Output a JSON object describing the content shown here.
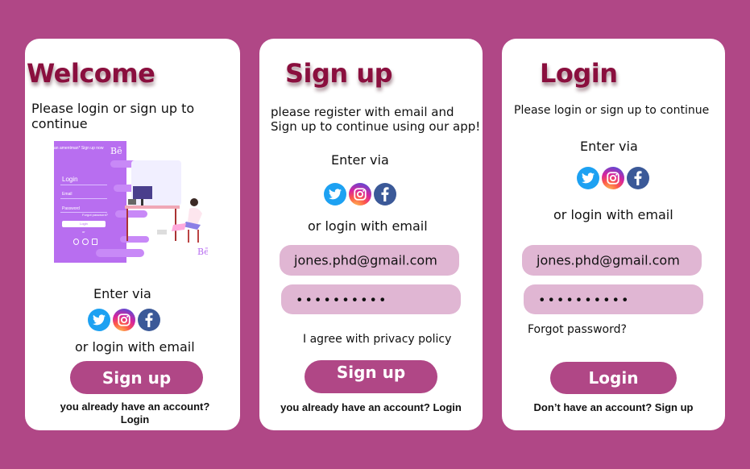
{
  "welcome": {
    "title": "Welcome",
    "subtitle": "Please login or sign up to continue",
    "illustration": {
      "header_text": "an amentman* Sign up now",
      "logo": "Bē",
      "form_title": "Login",
      "email_label": "Email",
      "password_label": "Password",
      "forgot_text": "Forgot password?",
      "login_label": "Login",
      "or_text": "or",
      "logo_bottom": "Bē"
    },
    "enter_via": "Enter via",
    "or_email": "or login with email",
    "signup_button": "Sign up",
    "footer_line1": "you already have an account?",
    "footer_line2": "Login"
  },
  "signup": {
    "title": "Sign up",
    "subtitle_line1": "please register with email and",
    "subtitle_line2": "Sign up to continue using our app!",
    "enter_via": "Enter via",
    "or_email": "or login with email",
    "email_value": "jones.phd@gmail.com",
    "password_value": "••••••••••",
    "privacy": "I agree with privacy policy",
    "signup_button": "Sign up",
    "footer": "you already have an account? Login"
  },
  "login": {
    "title": "Login",
    "subtitle": "Please login or sign up to continue",
    "enter_via": "Enter via",
    "or_email": "or login with email",
    "email_value": "jones.phd@gmail.com",
    "password_value": "••••••••••",
    "forgot": "Forgot password?",
    "login_button": "Login",
    "footer": "Don’t have an account? Sign up"
  },
  "icons": [
    "twitter-icon",
    "instagram-icon",
    "facebook-icon"
  ],
  "colors": {
    "background": "#b04786",
    "accent": "#b04786",
    "field": "#e0b6d3",
    "title": "#8a0f3e",
    "twitter": "#1da1f2",
    "facebook": "#3b5998"
  }
}
